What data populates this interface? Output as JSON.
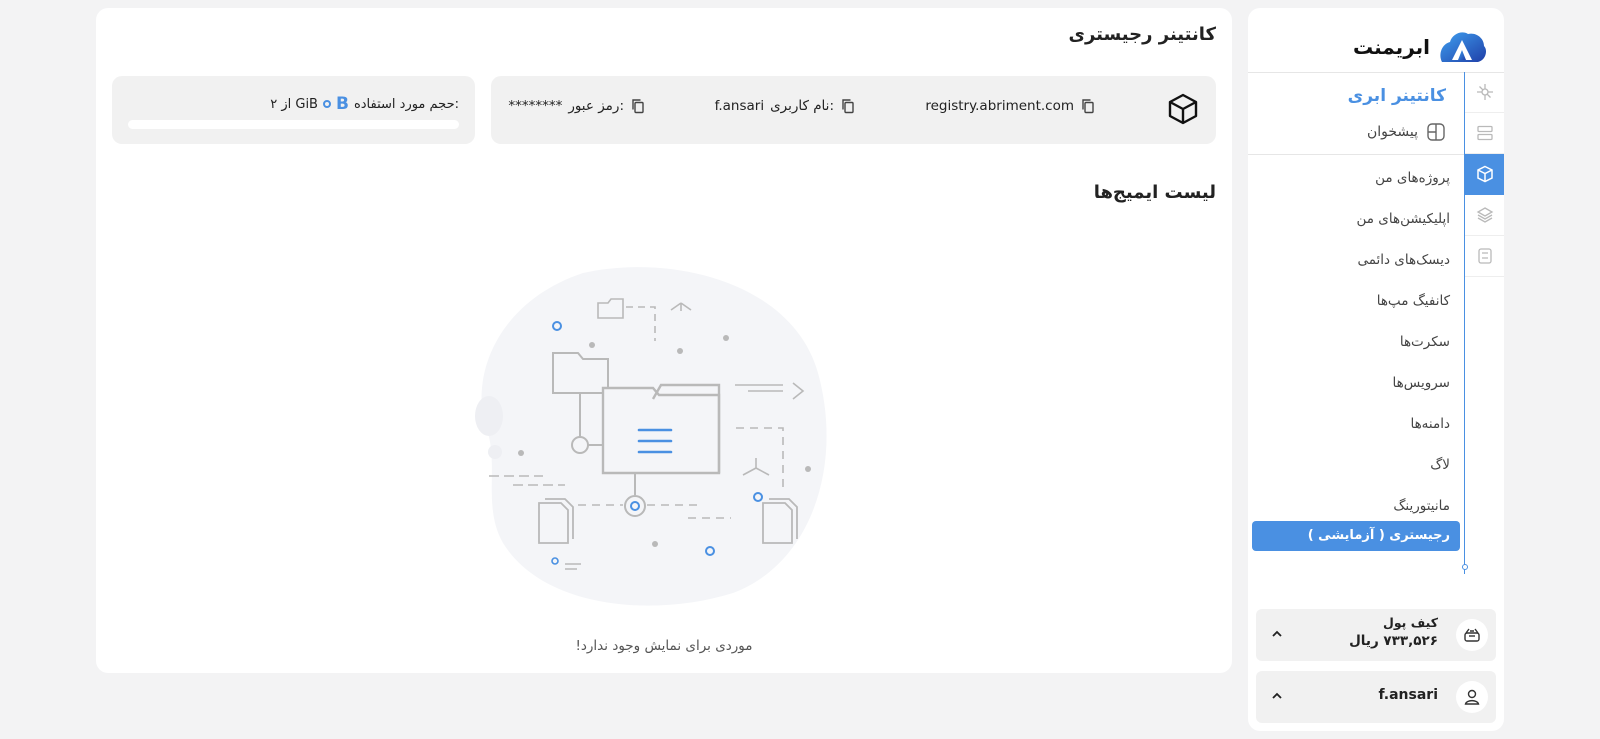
{
  "brand": {
    "name": "ابریمنت"
  },
  "sidebar": {
    "section_title": "کانتینر ابری",
    "dashboard_label": "پیشخوان",
    "rail_icons": [
      "kubernetes-icon",
      "server-icon",
      "container-icon",
      "layers-icon",
      "storage-icon"
    ],
    "items": [
      {
        "label": "پروژه‌های من"
      },
      {
        "label": "اپلیکیشن‌های من"
      },
      {
        "label": "دیسک‌های دائمی"
      },
      {
        "label": "کانفیگ مپ‌ها"
      },
      {
        "label": "سکرت‌ها"
      },
      {
        "label": "سرویس‌ها"
      },
      {
        "label": "دامنه‌ها"
      },
      {
        "label": "لاگ"
      },
      {
        "label": "مانیتورینگ"
      }
    ],
    "active_item": "رجیستری ( آزمایشی )",
    "wallet": {
      "label": "کیف پول",
      "amount": "۷۳۳,۵۲۶ ریال"
    },
    "user": {
      "name": "f.ansari"
    }
  },
  "main": {
    "title": "کانتینر رجیستری",
    "registry": {
      "url": "registry.abriment.com",
      "username_label": "نام کاربری:",
      "username": "f.ansari",
      "password_label": "رمز عبور:",
      "password": "********"
    },
    "quota": {
      "label": "حجم مورد استفاده:",
      "used": "B",
      "of_label": "از ۲ GiB",
      "used_fraction": 0
    },
    "list_title": "لیست ایمیج‌ها",
    "empty_text": "موردی برای نمایش وجود ندارد!"
  },
  "colors": {
    "accent": "#4a90e2",
    "background": "#f3f3f4",
    "card": "#f1f1f1"
  }
}
